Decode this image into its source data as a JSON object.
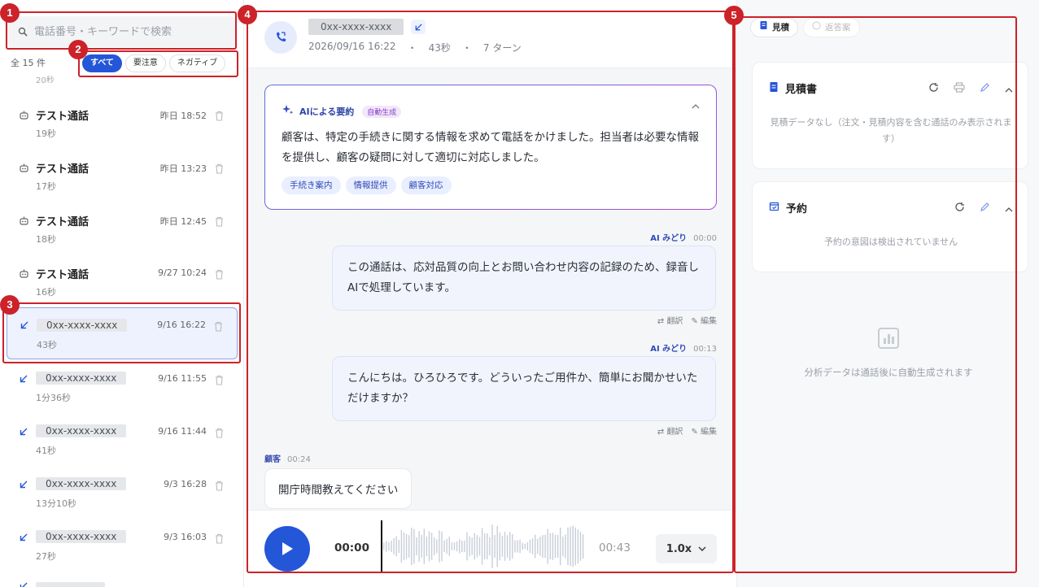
{
  "sidebar": {
    "search": {
      "placeholder": "電話番号・キーワードで検索"
    },
    "count": "全 15 件",
    "filters": [
      {
        "label": "すべて",
        "active": true
      },
      {
        "label": "要注意",
        "active": false
      },
      {
        "label": "ネガティブ",
        "active": false
      }
    ],
    "partial_item_sub": "20秒",
    "items": [
      {
        "kind": "test",
        "title": "テスト通話",
        "sub": "19秒",
        "time": "昨日 18:52"
      },
      {
        "kind": "test",
        "title": "テスト通話",
        "sub": "17秒",
        "time": "昨日 13:23"
      },
      {
        "kind": "test",
        "title": "テスト通話",
        "sub": "18秒",
        "time": "昨日 12:45"
      },
      {
        "kind": "test",
        "title": "テスト通話",
        "sub": "16秒",
        "time": "9/27 10:24"
      },
      {
        "kind": "call",
        "title": "0xx-xxxx-xxxx",
        "sub": "43秒",
        "time": "9/16 16:22",
        "selected": true
      },
      {
        "kind": "call",
        "title": "0xx-xxxx-xxxx",
        "sub": "1分36秒",
        "time": "9/16 11:55"
      },
      {
        "kind": "call",
        "title": "0xx-xxxx-xxxx",
        "sub": "41秒",
        "time": "9/16 11:44"
      },
      {
        "kind": "call",
        "title": "0xx-xxxx-xxxx",
        "sub": "13分10秒",
        "time": "9/3 16:28"
      },
      {
        "kind": "call",
        "title": "0xx-xxxx-xxxx",
        "sub": "27秒",
        "time": "9/3 16:03"
      }
    ]
  },
  "header": {
    "number": "0xx-xxxx-xxxx",
    "date": "2026/09/16 16:22",
    "sep": "・",
    "duration": "43秒",
    "turns": "7 ターン"
  },
  "summary": {
    "title": "AIによる要約",
    "badge": "自動生成",
    "text": "顧客は、特定の手続きに関する情報を求めて電話をかけました。担当者は必要な情報を提供し、顧客の疑問に対して適切に対応しました。",
    "tags": [
      "手続き案内",
      "情報提供",
      "顧客対応"
    ]
  },
  "messages": [
    {
      "speaker": "AI みどり",
      "time": "00:00",
      "text": "この通話は、応対品質の向上とお問い合わせ内容の記録のため、録音しAIで処理しています。",
      "translate": "翻訳",
      "edit": "編集"
    },
    {
      "speaker": "AI みどり",
      "time": "00:13",
      "text": "こんにちは。ひろひろです。どういったご用件か、簡単にお聞かせいただけますか？",
      "translate": "翻訳",
      "edit": "編集"
    },
    {
      "speaker": "顧客",
      "time": "00:24",
      "text": "開庁時間教えてください"
    }
  ],
  "player": {
    "current": "00:00",
    "duration": "00:43",
    "speed": "1.0x",
    "progress": 0
  },
  "right": {
    "tabs": [
      {
        "label": "見積",
        "active": true
      },
      {
        "label": "返答案",
        "active": false
      }
    ],
    "quote": {
      "title": "見積書",
      "empty": "見積データなし（注文・見積内容を含む通話のみ表示されます）"
    },
    "reservation": {
      "title": "予約",
      "empty": "予約の意図は検出されていません"
    },
    "analysis_empty": "分析データは通話後に自動生成されます"
  },
  "annotations": [
    "1",
    "2",
    "3",
    "4",
    "5"
  ],
  "colors": {
    "accent": "#2456d8",
    "annotation": "#cc2229"
  }
}
